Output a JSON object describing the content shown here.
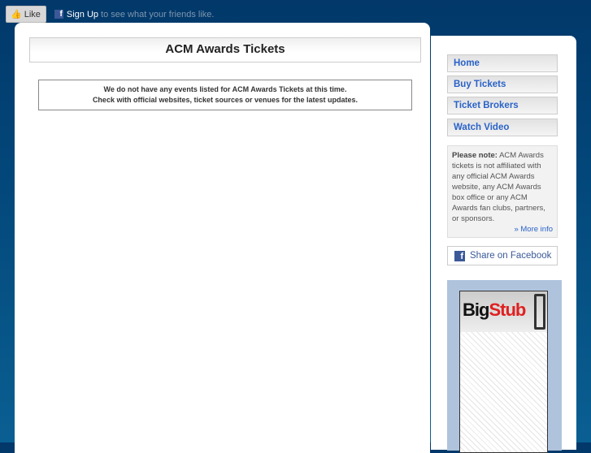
{
  "facebook_bar": {
    "like_label": "Like",
    "signup_label": "Sign Up",
    "signup_suffix": "to see what your friends like."
  },
  "main": {
    "title": "ACM Awards Tickets",
    "notice_line1": "We do not have any events listed for ACM Awards Tickets at this time.",
    "notice_line2": "Check with official websites, ticket sources or venues for the latest updates."
  },
  "sidebar": {
    "nav": [
      {
        "label": "Home"
      },
      {
        "label": "Buy Tickets"
      },
      {
        "label": "Ticket Brokers"
      },
      {
        "label": "Watch Video"
      }
    ],
    "note_label": "Please note:",
    "note_text": "ACM Awards tickets is not affiliated with any official ACM Awards website, any ACM Awards box office or any ACM Awards fan clubs, partners, or sponsors.",
    "more_info": "» More info",
    "share_label": "Share on Facebook"
  },
  "ad": {
    "logo_part1": "Big",
    "logo_part2": "Stub"
  }
}
